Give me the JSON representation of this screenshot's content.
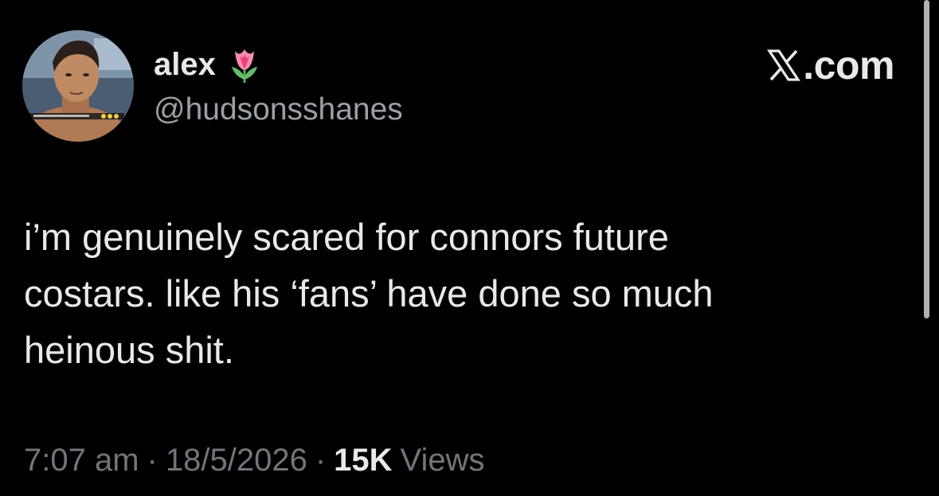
{
  "author": {
    "display_name": "alex",
    "handle": "@hudsonsshanes",
    "emoji_icon": "tulip-icon"
  },
  "brand": {
    "logo_icon": "x-logo-icon",
    "text": ".com"
  },
  "tweet": {
    "text": "i’m genuinely scared for connors future\ncostars. like his ‘fans’ have done so much\nheinous shit."
  },
  "meta": {
    "time": "7:07 am",
    "separator": "·",
    "date": "18/5/2026",
    "views_count": "15K",
    "views_label": "Views"
  },
  "colors": {
    "background": "#000000",
    "primary_text": "#e7e9ea",
    "secondary_text": "#71767b",
    "handle_text": "#9aa0a6"
  }
}
